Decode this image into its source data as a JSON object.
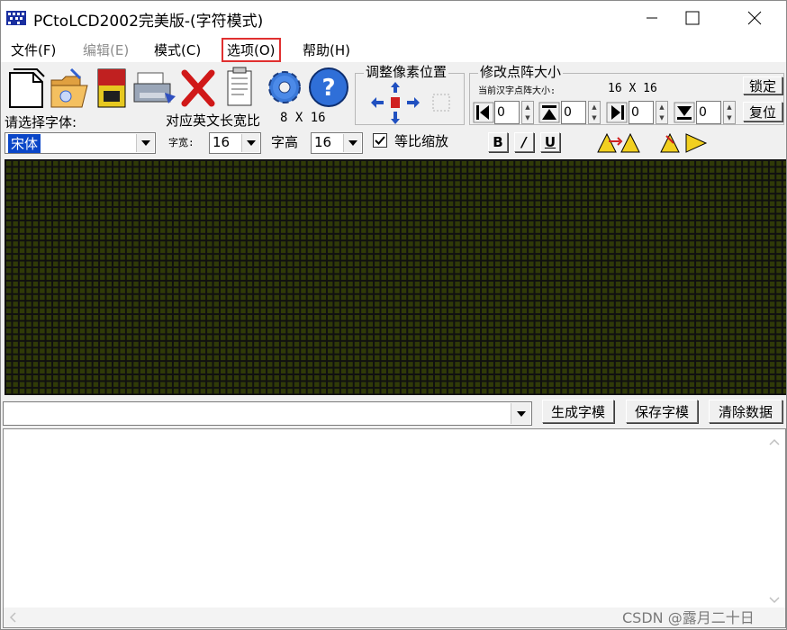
{
  "window": {
    "title": "PCtoLCD2002完美版-(字符模式)"
  },
  "menu": [
    {
      "label": "文件(F)",
      "enabled": true
    },
    {
      "label": "编辑(E)",
      "enabled": false
    },
    {
      "label": "模式(C)",
      "enabled": true
    },
    {
      "label": "选项(O)",
      "enabled": true,
      "highlighted": true
    },
    {
      "label": "帮助(H)",
      "enabled": true
    }
  ],
  "toolbar_icons": [
    "new-file-icon",
    "open-folder-icon",
    "save-disk-icon",
    "print-icon",
    "delete-x-icon",
    "notepad-icon",
    "gear-icon",
    "help-icon"
  ],
  "pixel_adjust": {
    "title": "调整像素位置"
  },
  "resize": {
    "title": "修改点阵大小",
    "current_label": "当前汉字点阵大小:",
    "current_value": "16 X 16",
    "lock_label": "锁定",
    "reset_label": "复位",
    "spinners": [
      "0",
      "0",
      "0",
      "0"
    ]
  },
  "font": {
    "prompt": "请选择字体:",
    "selected": "宋体",
    "english_ratio_label": "对应英文长宽比",
    "english_ratio_value": "8 X 16",
    "width_label": "字宽:",
    "width_value": "16",
    "height_label": "字高",
    "height_value": "16",
    "proportional_label": "等比缩放",
    "proportional_checked": true
  },
  "style_buttons": [
    "B",
    "/",
    "U"
  ],
  "actions": {
    "generate": "生成字模",
    "save": "保存字模",
    "clear": "清除数据"
  },
  "watermark": "CSDN @露月二十日"
}
